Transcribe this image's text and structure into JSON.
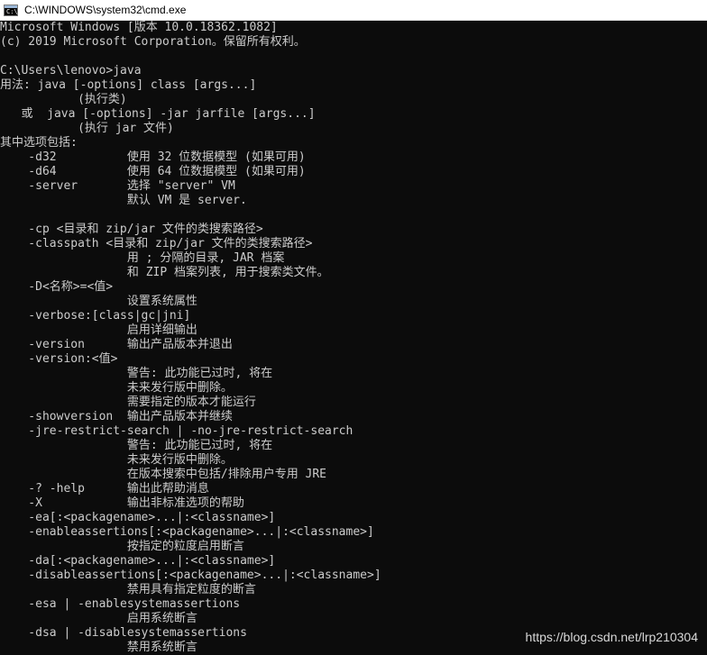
{
  "window": {
    "title": "C:\\WINDOWS\\system32\\cmd.exe",
    "icon": "cmd-window-icon",
    "icon_text": "C:\\"
  },
  "console": {
    "lines": [
      "Microsoft Windows [版本 10.0.18362.1082]",
      "(c) 2019 Microsoft Corporation。保留所有权利。",
      "",
      "C:\\Users\\lenovo>java",
      "用法: java [-options] class [args...]",
      "           (执行类)",
      "   或  java [-options] -jar jarfile [args...]",
      "           (执行 jar 文件)",
      "其中选项包括:",
      "    -d32          使用 32 位数据模型 (如果可用)",
      "    -d64          使用 64 位数据模型 (如果可用)",
      "    -server       选择 \"server\" VM",
      "                  默认 VM 是 server.",
      "",
      "    -cp <目录和 zip/jar 文件的类搜索路径>",
      "    -classpath <目录和 zip/jar 文件的类搜索路径>",
      "                  用 ; 分隔的目录, JAR 档案",
      "                  和 ZIP 档案列表, 用于搜索类文件。",
      "    -D<名称>=<值>",
      "                  设置系统属性",
      "    -verbose:[class|gc|jni]",
      "                  启用详细输出",
      "    -version      输出产品版本并退出",
      "    -version:<值>",
      "                  警告: 此功能已过时, 将在",
      "                  未来发行版中删除。",
      "                  需要指定的版本才能运行",
      "    -showversion  输出产品版本并继续",
      "    -jre-restrict-search | -no-jre-restrict-search",
      "                  警告: 此功能已过时, 将在",
      "                  未来发行版中删除。",
      "                  在版本搜索中包括/排除用户专用 JRE",
      "    -? -help      输出此帮助消息",
      "    -X            输出非标准选项的帮助",
      "    -ea[:<packagename>...|:<classname>]",
      "    -enableassertions[:<packagename>...|:<classname>]",
      "                  按指定的粒度启用断言",
      "    -da[:<packagename>...|:<classname>]",
      "    -disableassertions[:<packagename>...|:<classname>]",
      "                  禁用具有指定粒度的断言",
      "    -esa | -enablesystemassertions",
      "                  启用系统断言",
      "    -dsa | -disablesystemassertions",
      "                  禁用系统断言"
    ]
  },
  "watermark": "https://blog.csdn.net/lrp210304",
  "colors": {
    "background": "#0c0c0c",
    "text": "#cccccc",
    "titlebar": "#ffffff"
  }
}
